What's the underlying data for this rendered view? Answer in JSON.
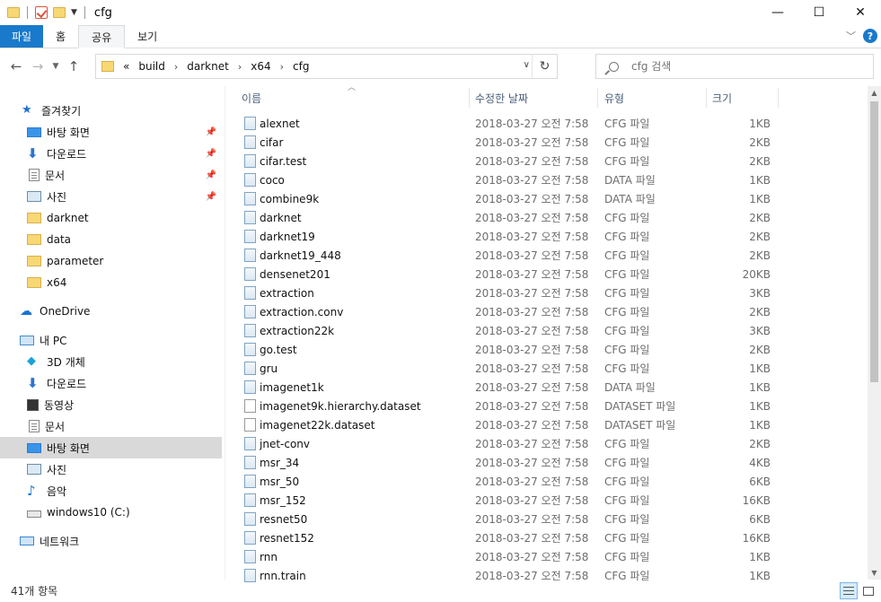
{
  "window": {
    "title": "cfg",
    "controls": {
      "minimize": "—",
      "maximize": "☐",
      "close": "✕"
    }
  },
  "ribbon": {
    "tabs": [
      {
        "label": "파일"
      },
      {
        "label": "홈"
      },
      {
        "label": "공유"
      },
      {
        "label": "보기"
      }
    ],
    "collapse_icon": "chevron-down-icon",
    "help_label": "?"
  },
  "address_bar": {
    "overflow": "«",
    "crumbs": [
      "build",
      "darknet",
      "x64",
      "cfg"
    ]
  },
  "search": {
    "placeholder": "cfg 검색"
  },
  "nav_pane": {
    "quick_access": {
      "label": "즐겨찾기",
      "items": [
        {
          "label": "바탕 화면",
          "icon": "desktop-icon",
          "pinned": true
        },
        {
          "label": "다운로드",
          "icon": "download-icon",
          "pinned": true
        },
        {
          "label": "문서",
          "icon": "document-icon",
          "pinned": true
        },
        {
          "label": "사진",
          "icon": "picture-icon",
          "pinned": true
        },
        {
          "label": "darknet",
          "icon": "folder-icon",
          "pinned": false
        },
        {
          "label": "data",
          "icon": "folder-icon",
          "pinned": false
        },
        {
          "label": "parameter",
          "icon": "folder-icon",
          "pinned": false
        },
        {
          "label": "x64",
          "icon": "folder-icon",
          "pinned": false
        }
      ]
    },
    "onedrive": {
      "label": "OneDrive"
    },
    "this_pc": {
      "label": "내 PC",
      "items": [
        {
          "label": "3D 개체",
          "icon": "3d-objects-icon"
        },
        {
          "label": "다운로드",
          "icon": "download-icon"
        },
        {
          "label": "동영상",
          "icon": "video-icon"
        },
        {
          "label": "문서",
          "icon": "document-icon"
        },
        {
          "label": "바탕 화면",
          "icon": "desktop-icon",
          "selected": true
        },
        {
          "label": "사진",
          "icon": "picture-icon"
        },
        {
          "label": "음악",
          "icon": "music-icon"
        },
        {
          "label": "windows10 (C:)",
          "icon": "drive-icon"
        }
      ]
    },
    "network": {
      "label": "네트워크"
    }
  },
  "columns": {
    "name": "이름",
    "modified": "수정한 날짜",
    "type": "유형",
    "size": "크기"
  },
  "files": [
    {
      "name": "alexnet",
      "modified": "2018-03-27 오전 7:58",
      "type": "CFG 파일",
      "size": "1KB",
      "icon": "cfg-file-icon"
    },
    {
      "name": "cifar",
      "modified": "2018-03-27 오전 7:58",
      "type": "CFG 파일",
      "size": "2KB",
      "icon": "cfg-file-icon"
    },
    {
      "name": "cifar.test",
      "modified": "2018-03-27 오전 7:58",
      "type": "CFG 파일",
      "size": "2KB",
      "icon": "cfg-file-icon"
    },
    {
      "name": "coco",
      "modified": "2018-03-27 오전 7:58",
      "type": "DATA 파일",
      "size": "1KB",
      "icon": "data-file-icon"
    },
    {
      "name": "combine9k",
      "modified": "2018-03-27 오전 7:58",
      "type": "DATA 파일",
      "size": "1KB",
      "icon": "data-file-icon"
    },
    {
      "name": "darknet",
      "modified": "2018-03-27 오전 7:58",
      "type": "CFG 파일",
      "size": "2KB",
      "icon": "cfg-file-icon"
    },
    {
      "name": "darknet19",
      "modified": "2018-03-27 오전 7:58",
      "type": "CFG 파일",
      "size": "2KB",
      "icon": "cfg-file-icon"
    },
    {
      "name": "darknet19_448",
      "modified": "2018-03-27 오전 7:58",
      "type": "CFG 파일",
      "size": "2KB",
      "icon": "cfg-file-icon"
    },
    {
      "name": "densenet201",
      "modified": "2018-03-27 오전 7:58",
      "type": "CFG 파일",
      "size": "20KB",
      "icon": "cfg-file-icon"
    },
    {
      "name": "extraction",
      "modified": "2018-03-27 오전 7:58",
      "type": "CFG 파일",
      "size": "3KB",
      "icon": "cfg-file-icon"
    },
    {
      "name": "extraction.conv",
      "modified": "2018-03-27 오전 7:58",
      "type": "CFG 파일",
      "size": "2KB",
      "icon": "cfg-file-icon"
    },
    {
      "name": "extraction22k",
      "modified": "2018-03-27 오전 7:58",
      "type": "CFG 파일",
      "size": "3KB",
      "icon": "cfg-file-icon"
    },
    {
      "name": "go.test",
      "modified": "2018-03-27 오전 7:58",
      "type": "CFG 파일",
      "size": "2KB",
      "icon": "cfg-file-icon"
    },
    {
      "name": "gru",
      "modified": "2018-03-27 오전 7:58",
      "type": "CFG 파일",
      "size": "1KB",
      "icon": "cfg-file-icon"
    },
    {
      "name": "imagenet1k",
      "modified": "2018-03-27 오전 7:58",
      "type": "DATA 파일",
      "size": "1KB",
      "icon": "data-file-icon"
    },
    {
      "name": "imagenet9k.hierarchy.dataset",
      "modified": "2018-03-27 오전 7:58",
      "type": "DATASET 파일",
      "size": "1KB",
      "icon": "blank-file-icon"
    },
    {
      "name": "imagenet22k.dataset",
      "modified": "2018-03-27 오전 7:58",
      "type": "DATASET 파일",
      "size": "1KB",
      "icon": "blank-file-icon"
    },
    {
      "name": "jnet-conv",
      "modified": "2018-03-27 오전 7:58",
      "type": "CFG 파일",
      "size": "2KB",
      "icon": "cfg-file-icon"
    },
    {
      "name": "msr_34",
      "modified": "2018-03-27 오전 7:58",
      "type": "CFG 파일",
      "size": "4KB",
      "icon": "cfg-file-icon"
    },
    {
      "name": "msr_50",
      "modified": "2018-03-27 오전 7:58",
      "type": "CFG 파일",
      "size": "6KB",
      "icon": "cfg-file-icon"
    },
    {
      "name": "msr_152",
      "modified": "2018-03-27 오전 7:58",
      "type": "CFG 파일",
      "size": "16KB",
      "icon": "cfg-file-icon"
    },
    {
      "name": "resnet50",
      "modified": "2018-03-27 오전 7:58",
      "type": "CFG 파일",
      "size": "6KB",
      "icon": "cfg-file-icon"
    },
    {
      "name": "resnet152",
      "modified": "2018-03-27 오전 7:58",
      "type": "CFG 파일",
      "size": "16KB",
      "icon": "cfg-file-icon"
    },
    {
      "name": "rnn",
      "modified": "2018-03-27 오전 7:58",
      "type": "CFG 파일",
      "size": "1KB",
      "icon": "cfg-file-icon"
    },
    {
      "name": "rnn.train",
      "modified": "2018-03-27 오전 7:58",
      "type": "CFG 파일",
      "size": "1KB",
      "icon": "cfg-file-icon"
    }
  ],
  "status": {
    "item_count": "41개 항목"
  },
  "colors": {
    "file_tab": "#1979ca",
    "selected_nav": "#d9d9d9",
    "folder": "#f8d775",
    "header_text": "#4c607a",
    "muted_text": "#6d6d6d"
  }
}
